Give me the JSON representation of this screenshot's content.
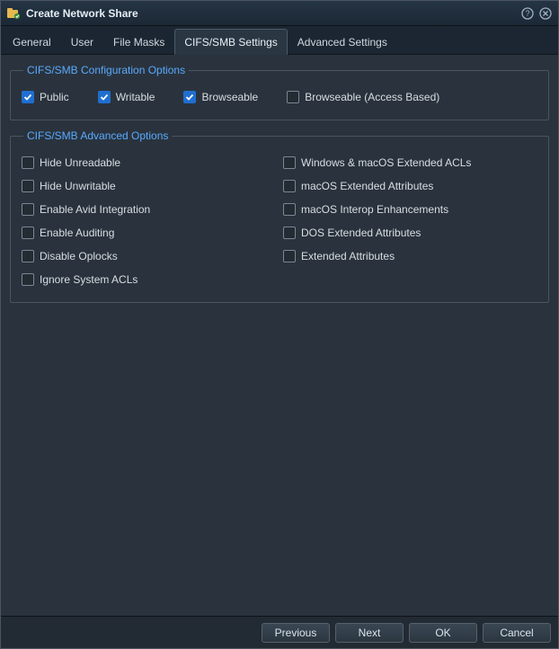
{
  "window": {
    "title": "Create Network Share"
  },
  "tabs": [
    {
      "label": "General"
    },
    {
      "label": "User"
    },
    {
      "label": "File Masks"
    },
    {
      "label": "CIFS/SMB Settings"
    },
    {
      "label": "Advanced Settings"
    }
  ],
  "active_tab_index": 3,
  "groups": {
    "config": {
      "legend": "CIFS/SMB Configuration Options",
      "options": [
        {
          "label": "Public",
          "checked": true
        },
        {
          "label": "Writable",
          "checked": true
        },
        {
          "label": "Browseable",
          "checked": true
        },
        {
          "label": "Browseable (Access Based)",
          "checked": false
        }
      ]
    },
    "advanced": {
      "legend": "CIFS/SMB Advanced Options",
      "left": [
        {
          "label": "Hide Unreadable",
          "checked": false
        },
        {
          "label": "Hide Unwritable",
          "checked": false
        },
        {
          "label": "Enable Avid Integration",
          "checked": false
        },
        {
          "label": "Enable Auditing",
          "checked": false
        },
        {
          "label": "Disable Oplocks",
          "checked": false
        },
        {
          "label": "Ignore System ACLs",
          "checked": false
        }
      ],
      "right": [
        {
          "label": "Windows & macOS Extended ACLs",
          "checked": false
        },
        {
          "label": "macOS Extended Attributes",
          "checked": false
        },
        {
          "label": "macOS Interop Enhancements",
          "checked": false
        },
        {
          "label": "DOS Extended Attributes",
          "checked": false
        },
        {
          "label": "Extended Attributes",
          "checked": false
        }
      ]
    }
  },
  "buttons": {
    "previous": "Previous",
    "next": "Next",
    "ok": "OK",
    "cancel": "Cancel"
  }
}
